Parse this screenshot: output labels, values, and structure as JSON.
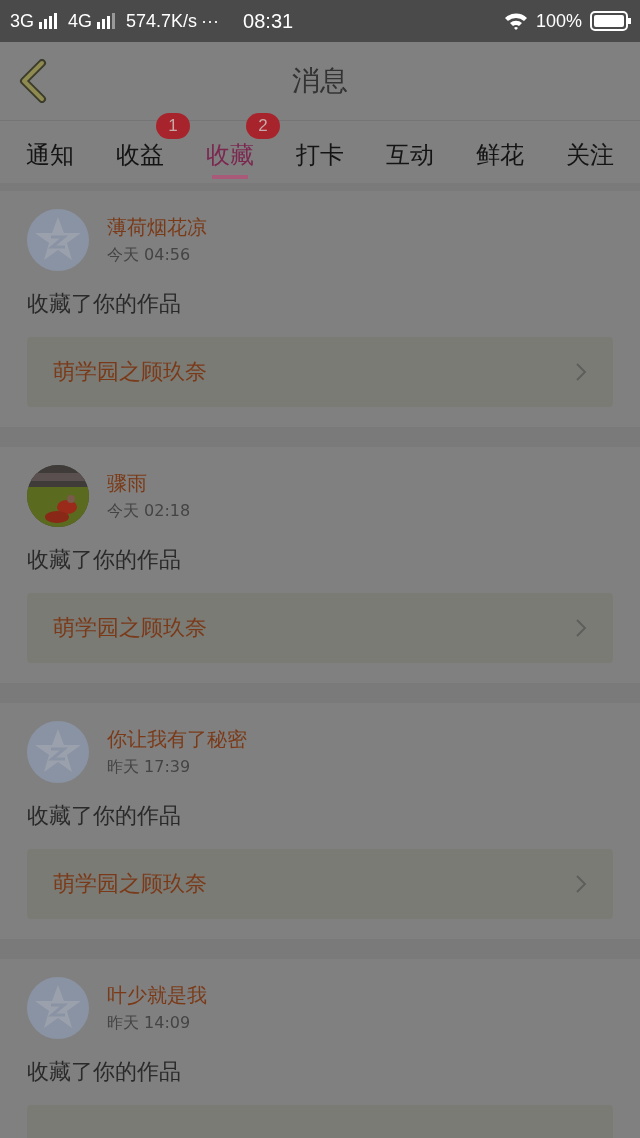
{
  "status_bar": {
    "network_1": "3G",
    "network_2": "4G",
    "speed": "574.7K/s",
    "more": "···",
    "time": "08:31",
    "battery": "100%"
  },
  "header": {
    "title": "消息"
  },
  "tabs": [
    {
      "label": "通知",
      "selected": false
    },
    {
      "label": "收益",
      "selected": false,
      "badge": "1"
    },
    {
      "label": "收藏",
      "selected": true,
      "badge": "2"
    },
    {
      "label": "打卡",
      "selected": false
    },
    {
      "label": "互动",
      "selected": false
    },
    {
      "label": "鲜花",
      "selected": false
    },
    {
      "label": "关注",
      "selected": false
    }
  ],
  "messages": [
    {
      "kind": "default",
      "name": "薄荷烟花凉",
      "time": "今天 04:56",
      "text": "收藏了你的作品",
      "work": "萌学园之顾玖奈"
    },
    {
      "kind": "picture",
      "name": "骤雨",
      "time": "今天 02:18",
      "text": "收藏了你的作品",
      "work": "萌学园之顾玖奈"
    },
    {
      "kind": "default",
      "name": "你让我有了秘密",
      "time": "昨天 17:39",
      "text": "收藏了你的作品",
      "work": "萌学园之顾玖奈"
    },
    {
      "kind": "default",
      "name": "叶少就是我",
      "time": "昨天 14:09",
      "text": "收藏了你的作品"
    }
  ]
}
